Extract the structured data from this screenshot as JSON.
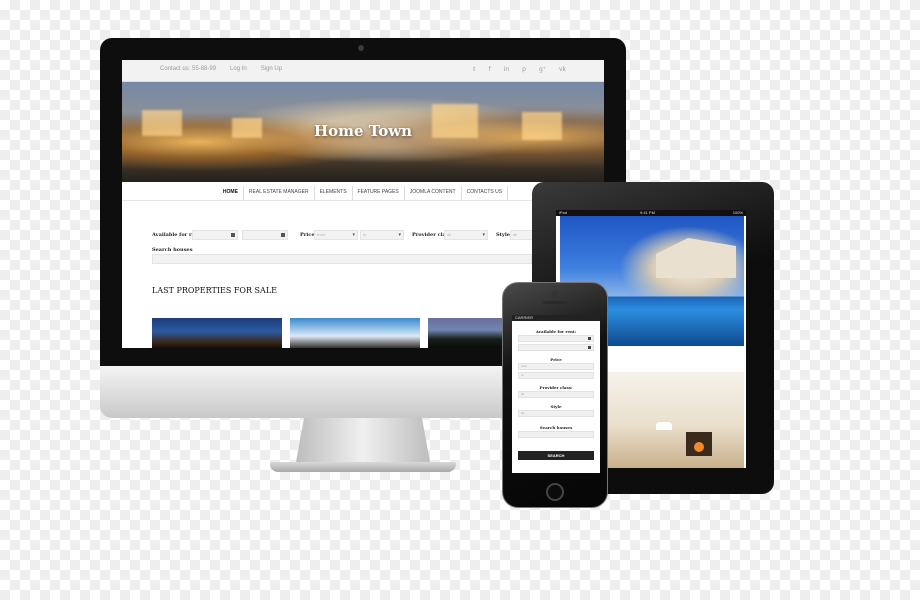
{
  "desktop": {
    "topbar": {
      "contact": "Contact us: 55-88-99",
      "login": "Log In",
      "signup": "Sign Up"
    },
    "social_icons": [
      "twitter-icon",
      "facebook-icon",
      "linkedin-icon",
      "pinterest-icon",
      "google-plus-icon",
      "vk-icon"
    ],
    "social_glyphs": [
      "𝕥",
      "f",
      "in",
      "p",
      "g⁺",
      "vk"
    ],
    "hero_title": "Home Town",
    "nav": {
      "home": "HOME",
      "real_estate": "REAL ESTATE MANAGER",
      "elements": "ELEMENTS",
      "feature_pages": "FEATURE PAGES",
      "joomla": "JOOMLA CONTENT",
      "contacts": "CONTACTS US"
    },
    "search": {
      "available_label": "Available for rent",
      "price_label": "Price",
      "price_from": "from",
      "price_to": "to",
      "provider_label": "Provider class:",
      "provider_value": "all",
      "style_label": "Style:",
      "style_value": "all",
      "search_houses_label": "Search houses"
    },
    "section_title": "LAST PROPERTIES FOR SALE"
  },
  "tablet": {
    "status_left": "iPad",
    "status_center": "9:41 PM",
    "status_right": "100%"
  },
  "phone": {
    "status": "CARRIER",
    "available_label": "Available for rent:",
    "price_label": "Price",
    "price_from": "from",
    "price_to": "to",
    "provider_label": "Provider class:",
    "provider_value": "all",
    "style_label": "Style",
    "style_value": "all",
    "search_houses_label": "Search houses",
    "search_button": "SEARCH"
  },
  "colors": {
    "device_black": "#0e0e0e",
    "chin_silver": "#e0e0e0",
    "nav_text": "#444444",
    "button_dark": "#222222"
  }
}
